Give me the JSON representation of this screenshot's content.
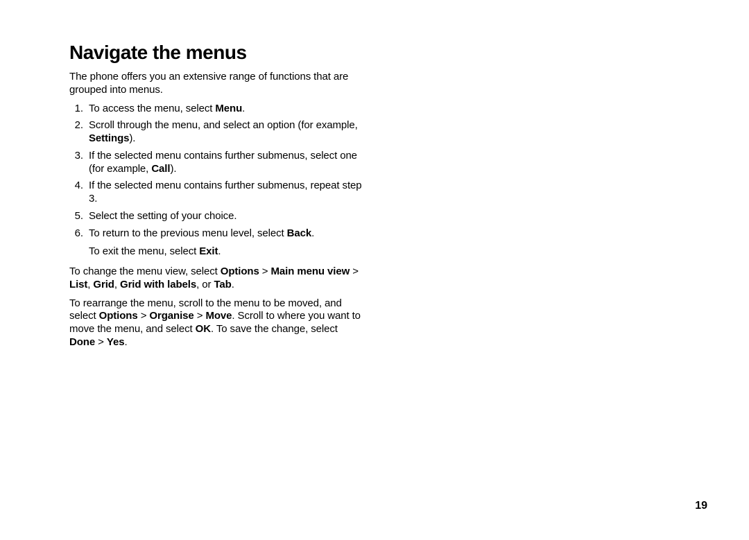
{
  "title": "Navigate the menus",
  "intro": "The phone offers you an extensive range of functions that are grouped into menus.",
  "steps": {
    "s1a": "To access the menu, select ",
    "s1b": "Menu",
    "s1c": ".",
    "s2a": "Scroll through the menu, and select an option (for example, ",
    "s2b": "Settings",
    "s2c": ").",
    "s3a": "If the selected menu contains further submenus, select one (for example, ",
    "s3b": "Call",
    "s3c": ").",
    "s4": "If the selected menu contains further submenus, repeat step 3.",
    "s5": "Select the setting of your choice.",
    "s6a": "To return to the previous menu level, select ",
    "s6b": "Back",
    "s6c": "."
  },
  "exit": {
    "a": "To exit the menu, select ",
    "b": "Exit",
    "c": "."
  },
  "para_view": {
    "a": "To change the menu view, select ",
    "b": "Options",
    "gt1": " > ",
    "c": "Main menu view",
    "gt2": " > ",
    "d": "List",
    "comma1": ", ",
    "e": "Grid",
    "comma2": ", ",
    "f": "Grid with labels",
    "or": ", or ",
    "g": "Tab",
    "end": "."
  },
  "para_rearrange": {
    "a": "To rearrange the menu, scroll to the menu to be moved, and select ",
    "b": "Options",
    "gt1": " > ",
    "c": "Organise",
    "gt2": " > ",
    "d": "Move",
    "e": ". Scroll to where you want to move the menu, and select ",
    "f": "OK",
    "g": ". To save the change, select ",
    "h": "Done",
    "gt3": " > ",
    "i": "Yes",
    "j": "."
  },
  "page_number": "19"
}
